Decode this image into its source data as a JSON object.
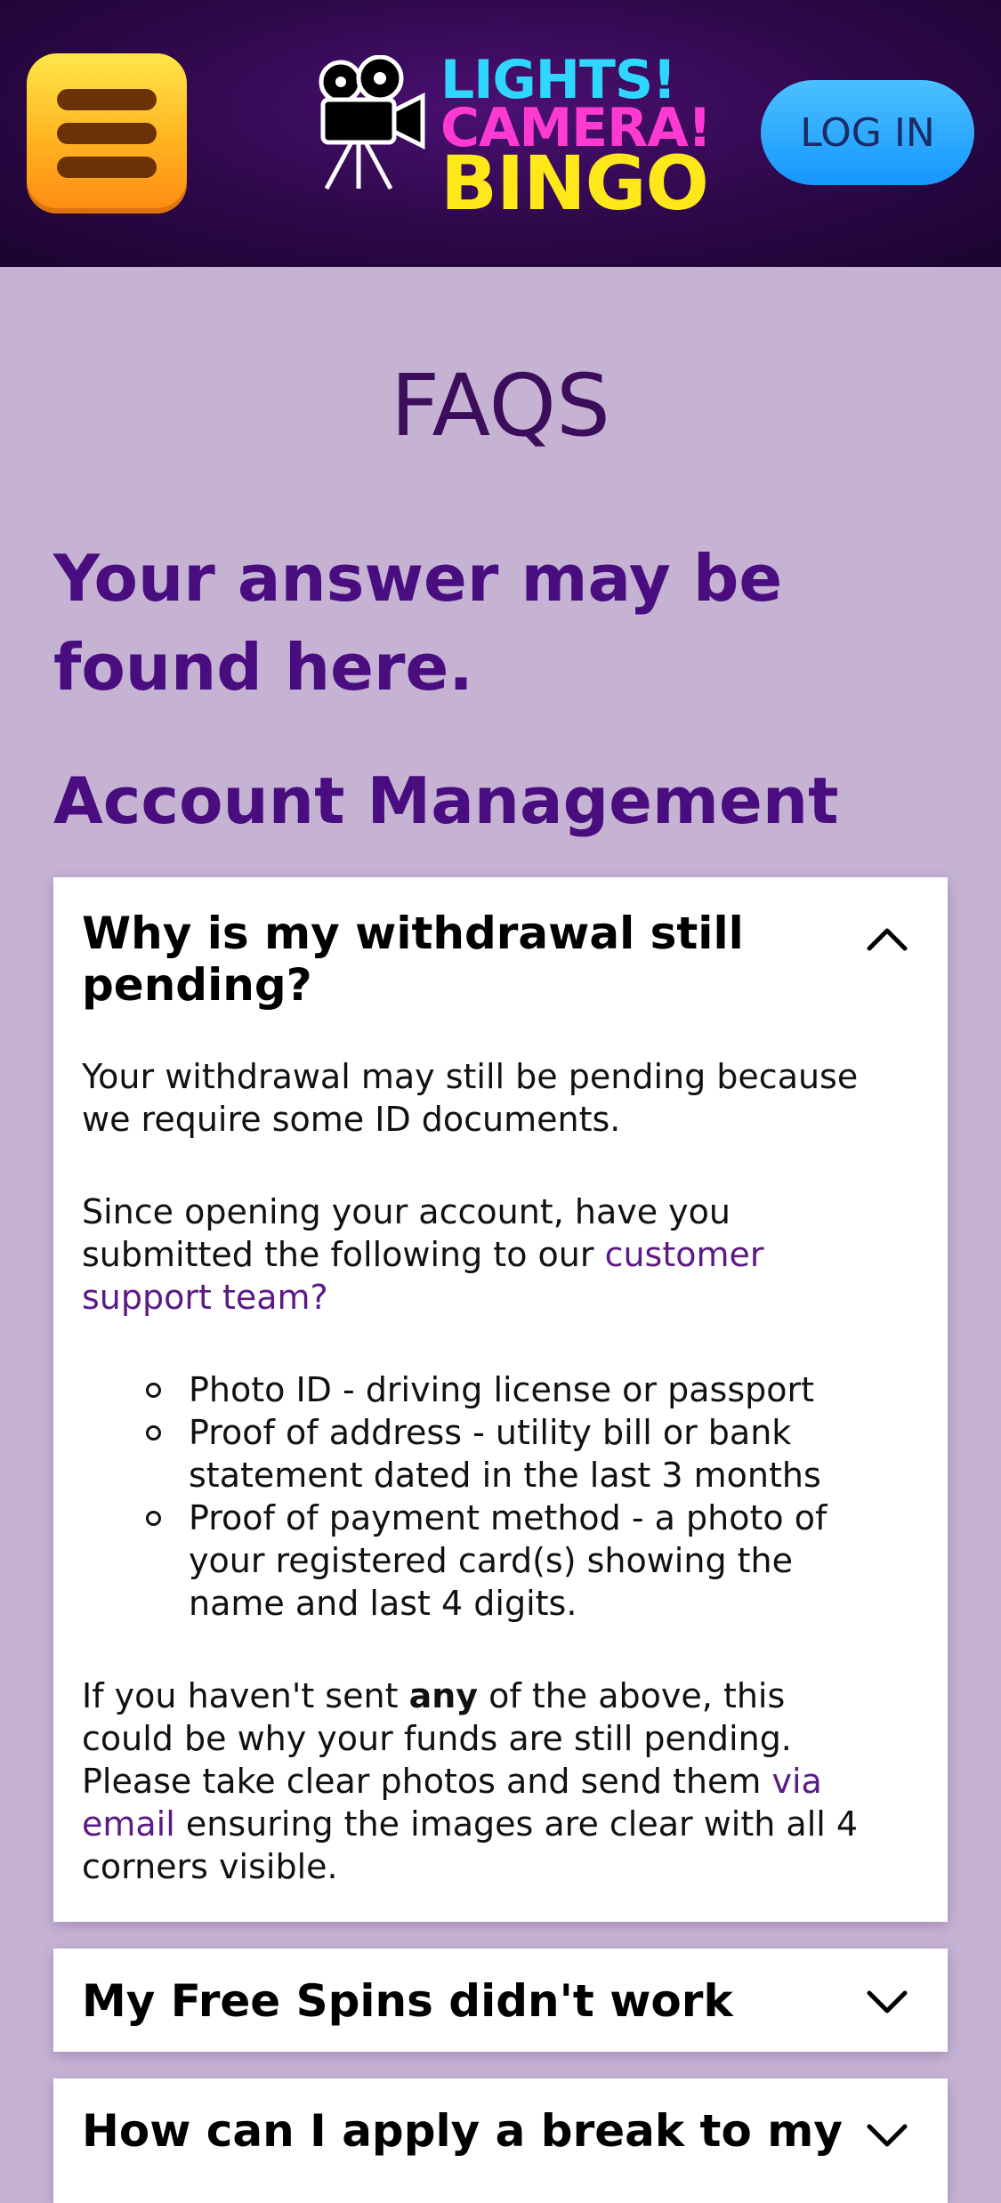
{
  "header": {
    "logo": {
      "line1": "LIGHTS!",
      "line2": "CAMERA!",
      "line3": "BINGO"
    },
    "login_label": "LOG IN"
  },
  "page": {
    "title": "FAQS",
    "intro": "Your answer may be found here.",
    "section_title": "Account Management"
  },
  "faqs": [
    {
      "question": "Why is my withdrawal still pending?",
      "expanded": true,
      "answer": {
        "p1": "Your withdrawal may still be pending because we require some ID documents.",
        "p2_before": "Since opening your account, have you submitted the following to our ",
        "p2_link": "customer support team?",
        "list": [
          "Photo ID - driving license or passport",
          "Proof of address - utility bill or bank statement dated in the last 3 months",
          "Proof of payment method - a photo of your registered card(s) showing the name and last 4 digits."
        ],
        "p3_a": "If you haven't sent ",
        "p3_bold": "any",
        "p3_b": " of the above, this could be why your funds are still pending. Please take clear photos and send them ",
        "p3_link": "via email",
        "p3_c": " ensuring the images are clear with all 4 corners visible."
      }
    },
    {
      "question": "My Free Spins didn't work",
      "expanded": false
    },
    {
      "question": "How can I apply a break to my",
      "expanded": false
    }
  ],
  "icons": {
    "menu": "hamburger-menu-icon",
    "logo_camera": "film-camera-icon",
    "expanded": "chevron-up-icon",
    "collapsed": "chevron-down-icon"
  },
  "colors": {
    "header_bg": "#2d0848",
    "page_bg": "#c6b3d4",
    "heading": "#4a0d80",
    "title": "#3b0d5a",
    "link": "#5b1a86",
    "menu_button": "#ffb320",
    "login_button": "#1697ff"
  }
}
